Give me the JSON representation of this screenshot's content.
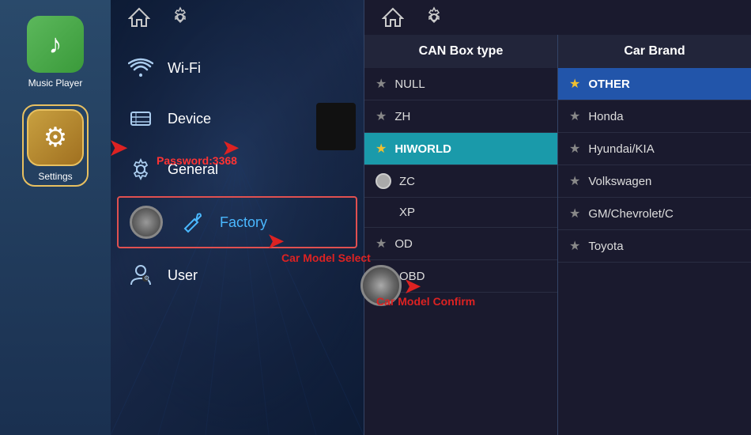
{
  "sidebar": {
    "apps": [
      {
        "id": "music-player",
        "label": "Music Player",
        "icon": "♪"
      },
      {
        "id": "settings",
        "label": "Settings",
        "icon": "⚙"
      }
    ]
  },
  "top_bar": {
    "home_icon": "⌂",
    "settings_icon": "⚙"
  },
  "menu": {
    "items": [
      {
        "id": "wifi",
        "label": "Wi-Fi",
        "icon": "wifi"
      },
      {
        "id": "device",
        "label": "Device",
        "icon": "device"
      },
      {
        "id": "general",
        "label": "General",
        "icon": "gear"
      },
      {
        "id": "factory",
        "label": "Factory",
        "icon": "wrench",
        "active": true,
        "labelColor": "blue"
      },
      {
        "id": "user",
        "label": "User",
        "icon": "user"
      }
    ],
    "password_label": "Password:3368"
  },
  "can_box": {
    "header": "CAN Box type",
    "items": [
      {
        "id": "null",
        "label": "NULL",
        "star": "normal"
      },
      {
        "id": "zh",
        "label": "ZH",
        "star": "normal"
      },
      {
        "id": "hiworld",
        "label": "HIWORLD",
        "star": "gold",
        "selected": true
      },
      {
        "id": "zc",
        "label": "ZC",
        "star": "circle"
      },
      {
        "id": "xp",
        "label": "XP",
        "star": "none"
      },
      {
        "id": "od",
        "label": "OD",
        "star": "normal"
      },
      {
        "id": "obd",
        "label": "OBD",
        "star": "msg"
      }
    ]
  },
  "car_brand": {
    "header": "Car Brand",
    "items": [
      {
        "id": "other",
        "label": "OTHER",
        "star": "gold",
        "selected": true
      },
      {
        "id": "honda",
        "label": "Honda",
        "star": "normal"
      },
      {
        "id": "hyundai",
        "label": "Hyundai/KIA",
        "star": "normal"
      },
      {
        "id": "volkswagen",
        "label": "Volkswagen",
        "star": "normal"
      },
      {
        "id": "gm",
        "label": "GM/Chevrolet/C",
        "star": "normal"
      },
      {
        "id": "toyota",
        "label": "Toyota",
        "star": "normal"
      }
    ]
  },
  "annotations": {
    "car_model_select": "Car Model Select",
    "car_model_confirm": "Car Model Confirm"
  }
}
